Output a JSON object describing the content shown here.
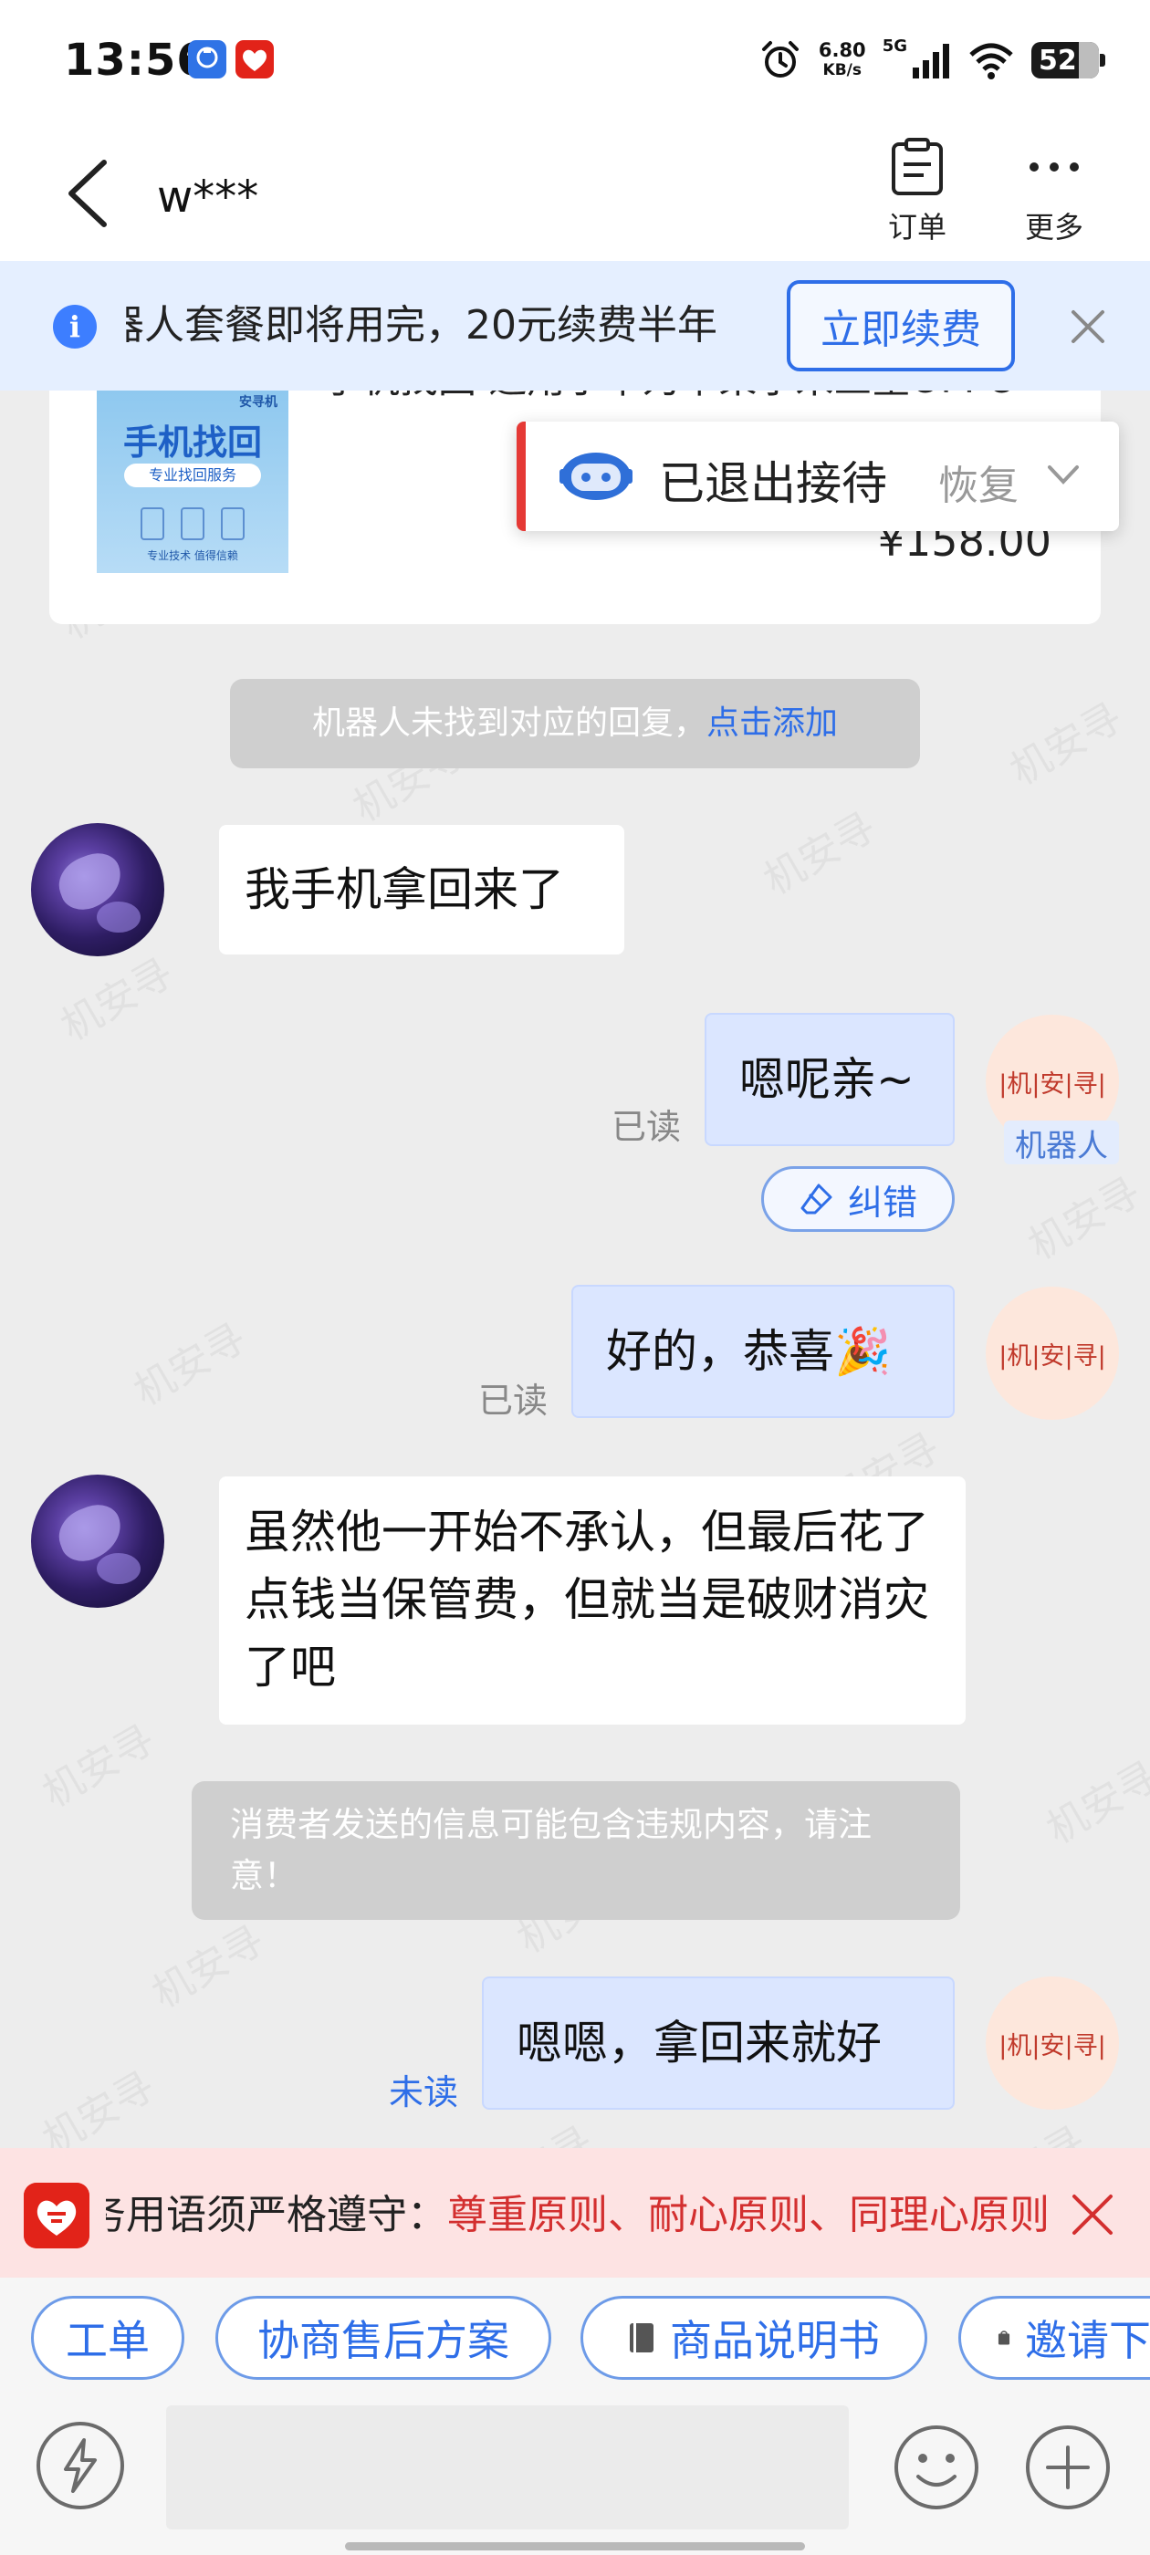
{
  "status_bar": {
    "time": "13:56",
    "net_speed": "6.80",
    "net_unit": "KB/s",
    "signal": "5G",
    "battery": "52"
  },
  "header": {
    "contact_name": "w***",
    "order_label": "订单",
    "more_label": "更多"
  },
  "renew_banner": {
    "text": "器人套餐即将用完，20元续费半年",
    "button": "立即续费"
  },
  "product": {
    "title": "手机找回 适用于华为苹果小米三星OPPO",
    "price": "¥158.00",
    "image_brand": "安寻机",
    "image_title": "手机找回",
    "image_subtitle": "专业找回服务",
    "image_footer": "专业技术 值得信赖"
  },
  "exit_popup": {
    "text": "已退出接待",
    "restore": "恢复"
  },
  "notices": {
    "robot_prefix": "机器人未找到对应的回复，",
    "robot_link": "点击添加",
    "violation": "消费者发送的信息可能包含违规内容，请注意！"
  },
  "messages": {
    "m1": "我手机拿回来了",
    "m2": "嗯呢亲~",
    "m2_status": "已读",
    "robot_tag": "机器人",
    "correct_label": "纠错",
    "m3": "好的，恭喜🎉",
    "m3_status": "已读",
    "m4": "虽然他一开始不承认，但最后花了点钱当保管费，但就当是破财消灾了吧",
    "m5": "嗯嗯，拿回来就好",
    "m5_status": "未读",
    "shop_avatar_text": "|机|安|寻|"
  },
  "reminder": {
    "prefix": "务用语须严格遵守：",
    "highlight": "尊重原则、耐心原则、同理心原则"
  },
  "chips": [
    "工单",
    "协商售后方案",
    "商品说明书",
    "邀请下单"
  ],
  "watermark": "机安寻",
  "colors": {
    "accent": "#2e6ee8",
    "bubble_out": "#dbe6ff",
    "warning": "#d32f2f",
    "background": "#ededed"
  }
}
